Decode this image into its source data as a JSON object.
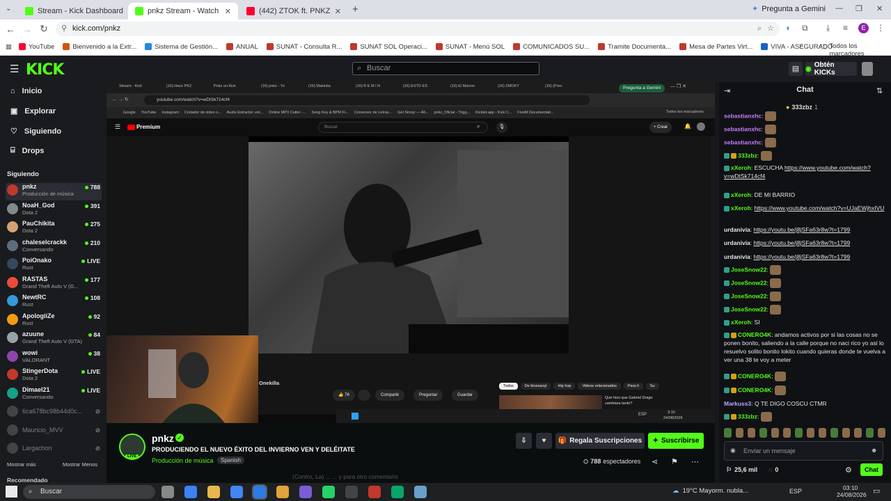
{
  "browser": {
    "tabs": [
      {
        "title": "Stream - Kick Dashboard",
        "color": "#53fc18"
      },
      {
        "title": "pnkz Stream - Watch Live o",
        "color": "#53fc18"
      },
      {
        "title": "(442) ZTOK ft. PNKZ, New TEM",
        "color": "#ff0033"
      }
    ],
    "new_tab": "+",
    "gemini": "Pregunta a Gemini",
    "url": "kick.com/pnkz",
    "bookmarks": [
      "YouTube",
      "Bienvenido a la Extr...",
      "Sistema de Gestión...",
      "ANUAL",
      "SUNAT - Consulta R...",
      "SUNAT SOL Operaci...",
      "SUNAT - Menú SOL",
      "COMUNICADOS SU...",
      "Tramite Documenta...",
      "Mesa de Partes Virt...",
      "VIVA - ASEGURADO"
    ],
    "bookmarks_folder": "Todos los marcadores",
    "profile_initial": "E"
  },
  "kick": {
    "logo": "KICK",
    "search_placeholder": "Buscar",
    "get_kicks": "Obtén KICKs",
    "nav": [
      "Inicio",
      "Explorar",
      "Siguiendo",
      "Drops"
    ],
    "following_title": "Siguiendo",
    "following": [
      {
        "name": "pnkz",
        "cat": "Producción de música",
        "viewers": "788",
        "color": "#c0392b"
      },
      {
        "name": "NoaH_God",
        "cat": "Dota 2",
        "viewers": "391",
        "color": "#7f8c8d"
      },
      {
        "name": "PauChikita",
        "cat": "Dota 2",
        "viewers": "275",
        "color": "#d4a373"
      },
      {
        "name": "chaleselcrackk",
        "cat": "Conversando",
        "viewers": "210",
        "color": "#5d6d7e"
      },
      {
        "name": "PoiOnako",
        "cat": "Rust",
        "viewers": "LIVE",
        "color": "#34495e"
      },
      {
        "name": "RASTAS",
        "cat": "Grand Theft Auto V (G...",
        "viewers": "177",
        "color": "#e74c3c"
      },
      {
        "name": "NewtRC",
        "cat": "Rust",
        "viewers": "108",
        "color": "#3498db"
      },
      {
        "name": "ApologiiZe",
        "cat": "Rust",
        "viewers": "92",
        "color": "#f39c12"
      },
      {
        "name": "azuune",
        "cat": "Grand Theft Auto V (GTA)",
        "viewers": "84",
        "color": "#95a5a6"
      },
      {
        "name": "wowi",
        "cat": "VALORANT",
        "viewers": "38",
        "color": "#8e44ad"
      },
      {
        "name": "StingerDota",
        "cat": "Dota 2",
        "viewers": "LIVE",
        "color": "#c0392b"
      },
      {
        "name": "Dimael21",
        "cat": "Conversando",
        "viewers": "LIVE",
        "color": "#16a085"
      }
    ],
    "offline": [
      "6ca678bc98b44d0c...",
      "Mauricio_MVV",
      "Largachon"
    ],
    "show_more": "Mostrar más",
    "show_less": "Mostrar Menos",
    "recommended": "Recomendado"
  },
  "player": {
    "tabs": [
      "Stream - Kick",
      "(16) Hace PK2",
      "Pnkz on Kick",
      "(16) pnkz - Yo",
      "(16) Makinita",
      "(16) R E M I N",
      "(16) ESTO ES",
      "(16) El Marron",
      "(16) ZMOKY",
      "(16) (Prev"
    ],
    "gemini": "Pregunta a Gemini",
    "url": "youtube.com/watch?v=wDtSk714cf4",
    "bookmarks": [
      "Google",
      "YouTube",
      "Instagram",
      "Cortador de video o...",
      "Audio Extractor: ext...",
      "Online MP3 Cutter -...",
      "Song Key & BPM Fi...",
      "Conversor de Letras...",
      "Get Sinoyi — All...",
      "pnkz_Oficial - Trigg...",
      "Kicklet.app - Kick C...",
      "FiveM Documentati..."
    ],
    "bookmarks_folder": "Todos los marcadores",
    "yt_logo": "Premium",
    "yt_search": "Buscar",
    "yt_create": "Crear",
    "channel": "Onekilla",
    "likes": "76",
    "share": "Compartir",
    "ask": "Preguntar",
    "save": "Guardar",
    "chips": [
      "Todos",
      "De bluesaoyi",
      "Hip hop",
      "Videos relacionados",
      "Para ti",
      "Su"
    ],
    "suggest_title": "Qué hizo que Gabriel Drago cambiara tanto?",
    "clock": "3:10",
    "date": "24/08/2026",
    "lang": "ESP"
  },
  "stream": {
    "streamer": "pnkz",
    "live": "LIVE",
    "title": "PRODUCIENDO EL NUEVO ÉXITO DEL INVIERNO VEN Y DELÉITATE",
    "category": "Producción de música",
    "tag": "Spanish",
    "gift": "Regala Suscripciones",
    "subscribe": "Suscribirse",
    "viewers": "788",
    "viewers_label": "espectadores",
    "overlay_text": "(Contro, La) ...",
    "overlay_text2": "... y para otro comentario"
  },
  "chat": {
    "title": "Chat",
    "pinned_user": "333zbz",
    "pinned_count": "1",
    "messages": [
      {
        "user": "sebastianxhc",
        "color": "#c77dff",
        "text": ""
      },
      {
        "user": "sebastianxhc",
        "color": "#c77dff",
        "text": ""
      },
      {
        "user": "sebastianxhc",
        "color": "#c77dff",
        "text": ""
      },
      {
        "user": "333zbz",
        "color": "#53fc18",
        "text": ""
      },
      {
        "user": "xXeroh",
        "color": "#53fc18",
        "text": "ESCUCHA ",
        "link": "https://www.youtube.com/watch?v=wDtSk714cf4"
      },
      {
        "user": "xXeroh",
        "color": "#53fc18",
        "text": "DE MI BARRIO"
      },
      {
        "user": "xXeroh",
        "color": "#53fc18",
        "text": "",
        "link": "https://www.youtube.com/watch?v=UJaEWjhxIVU"
      },
      {
        "user": "urdanivia",
        "color": "#e4e4e4",
        "text": "",
        "link": "https://youtu.be/j8jSFa63r8w?t=1799"
      },
      {
        "user": "urdanivia",
        "color": "#e4e4e4",
        "text": "",
        "link": "https://youtu.be/j8jSFa63r8w?t=1799"
      },
      {
        "user": "urdanivia",
        "color": "#e4e4e4",
        "text": "",
        "link": "https://youtu.be/j8jSFa63r8w?t=1799"
      },
      {
        "user": "JoseSnow22",
        "color": "#53fc18",
        "text": ""
      },
      {
        "user": "JoseSnow22",
        "color": "#53fc18",
        "text": ""
      },
      {
        "user": "JoseSnow22",
        "color": "#53fc18",
        "text": ""
      },
      {
        "user": "JoseSnow22",
        "color": "#53fc18",
        "text": ""
      },
      {
        "user": "xXeroh",
        "color": "#53fc18",
        "text": "SI"
      },
      {
        "user": "CONERO4K",
        "color": "#53fc18",
        "text": "andamos activos por si las cosas no se ponen bonito, saliendo a la calle porque no naci rico yo asi lo resuelvo solito bonito lokito cuando quieras donde te vuelva a ver una 38 te voy a meter"
      },
      {
        "user": "CONERO4K",
        "color": "#53fc18",
        "text": ""
      },
      {
        "user": "CONERO4K",
        "color": "#53fc18",
        "text": ""
      },
      {
        "user": "Markuss3",
        "color": "#b9a5ff",
        "text": "Q TE DIGO COSCU CTMR"
      },
      {
        "user": "333zbz",
        "color": "#53fc18",
        "text": ""
      }
    ],
    "input_placeholder": "Enviar un mensaje",
    "kicks": "25,6 mil",
    "points": "0",
    "send": "Chat"
  },
  "taskbar": {
    "search": "Buscar",
    "weather": "19°C  Mayorm. nubla...",
    "lang": "ESP",
    "time": "03:10",
    "date": "24/08/2026"
  }
}
